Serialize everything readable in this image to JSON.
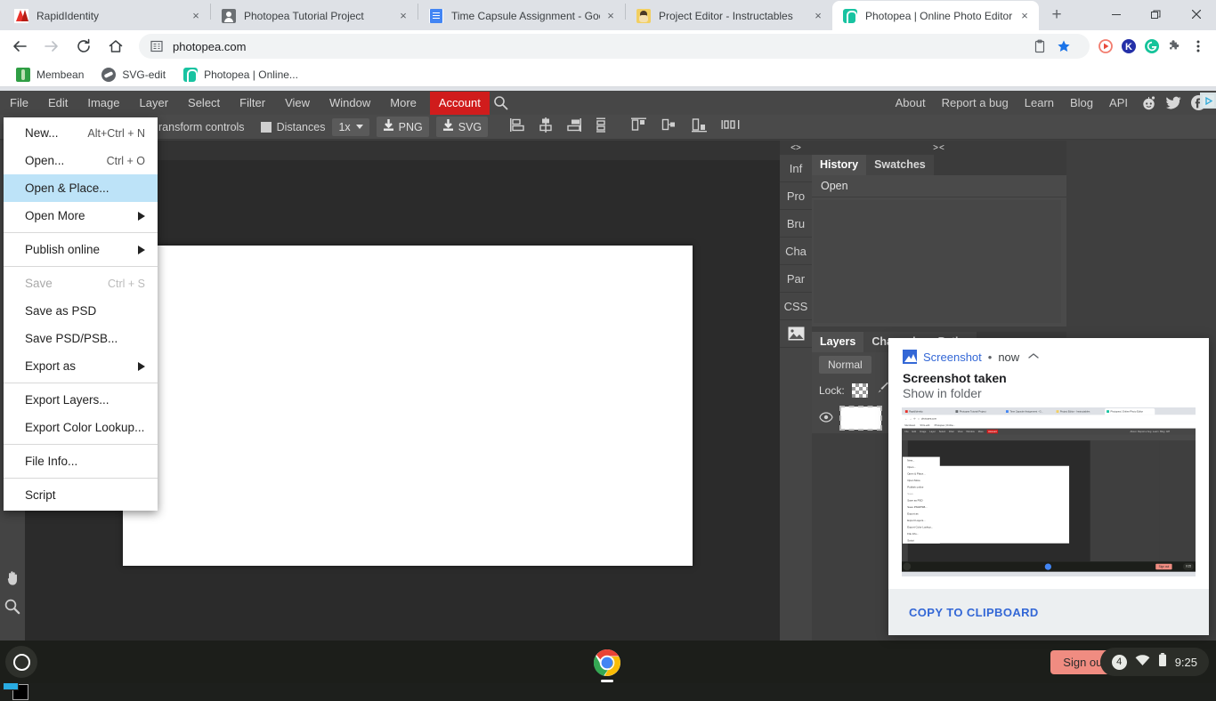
{
  "browser": {
    "tabs": [
      {
        "title": "RapidIdentity",
        "favicon": "rapididentity-icon",
        "active": false
      },
      {
        "title": "Photopea Tutorial Project",
        "favicon": "contact-card-icon",
        "active": false
      },
      {
        "title": "Time Capsule Assignment - Goo",
        "favicon": "google-docs-icon",
        "active": false
      },
      {
        "title": "Project Editor - Instructables",
        "favicon": "instructables-icon",
        "active": false
      },
      {
        "title": "Photopea | Online Photo Editor",
        "favicon": "photopea-icon",
        "active": true
      }
    ],
    "tab_close_label": "×",
    "new_tab_label": "+",
    "window_controls": {
      "minimize": "–",
      "maximize": "❐",
      "close": "✕"
    },
    "omnibox": {
      "url": "photopea.com",
      "site_icon": "page-info-icon"
    },
    "omnibox_actions": [
      "clipboard-icon",
      "bookmark-star-icon"
    ],
    "extensions": [
      "screencast-icon",
      "kami-icon",
      "grammarly-icon",
      "puzzle-icon",
      "chrome-menu-icon"
    ],
    "bookmarks": [
      {
        "label": "Membean",
        "icon": "membean-icon"
      },
      {
        "label": "SVG-edit",
        "icon": "svgedit-icon"
      },
      {
        "label": "Photopea | Online...",
        "icon": "photopea-icon"
      }
    ]
  },
  "photopea": {
    "menu": [
      "File",
      "Edit",
      "Image",
      "Layer",
      "Select",
      "Filter",
      "View",
      "Window",
      "More"
    ],
    "account_label": "Account",
    "search_icon": "magnifier-icon",
    "right_links": [
      "About",
      "Report a bug",
      "Learn",
      "Blog",
      "API"
    ],
    "social": [
      "reddit-icon",
      "twitter-icon",
      "facebook-icon"
    ],
    "options": {
      "transform_controls": "ransform controls",
      "distances": "Distances",
      "zoom_value": "1x",
      "png_label": "PNG",
      "svg_label": "SVG",
      "align_icons": [
        "align-left-icon",
        "align-center-horizontal-icon",
        "align-right-icon",
        "distribute-vertical-icon"
      ],
      "align_icons2": [
        "align-top-icon",
        "align-middle-icon",
        "align-bottom-icon",
        "distribute-horizontal-icon"
      ]
    },
    "tools": [
      "hand-tool",
      "zoom-tool"
    ],
    "colors": {
      "foreground": "#29abe2",
      "background": "#000000",
      "accent_red": "#d01c1c"
    },
    "side_strip": {
      "collapse": "<>",
      "items": [
        "Inf",
        "Pro",
        "Bru",
        "Cha",
        "Par",
        "CSS"
      ],
      "image_icon": "image-icon"
    },
    "panel_handle": "><",
    "top_panel": {
      "tabs": [
        "History",
        "Swatches"
      ],
      "active_tab": "History",
      "history_items": [
        "Open"
      ]
    },
    "layers_panel": {
      "tabs": [
        "Layers",
        "Channels",
        "Paths"
      ],
      "active_tab": "Layers",
      "blend_mode": "Normal",
      "lock_label": "Lock:",
      "eye_icon": "eye-icon",
      "lock_icons": [
        "transparency-lock-icon",
        "brush-lock-icon"
      ]
    }
  },
  "file_menu": {
    "items": [
      {
        "label": "New...",
        "shortcut": "Alt+Ctrl + N",
        "state": "normal"
      },
      {
        "label": "Open...",
        "shortcut": "Ctrl + O",
        "state": "normal"
      },
      {
        "label": "Open & Place...",
        "shortcut": "",
        "state": "selected"
      },
      {
        "label": "Open More",
        "shortcut": "",
        "state": "submenu"
      },
      {
        "separator": true
      },
      {
        "label": "Publish online",
        "shortcut": "",
        "state": "submenu"
      },
      {
        "separator": true
      },
      {
        "label": "Save",
        "shortcut": "Ctrl + S",
        "state": "disabled"
      },
      {
        "label": "Save as PSD",
        "shortcut": "",
        "state": "normal"
      },
      {
        "label": "Save PSD/PSB...",
        "shortcut": "",
        "state": "normal"
      },
      {
        "label": "Export as",
        "shortcut": "",
        "state": "submenu"
      },
      {
        "separator": true
      },
      {
        "label": "Export Layers...",
        "shortcut": "",
        "state": "normal"
      },
      {
        "label": "Export Color Lookup...",
        "shortcut": "",
        "state": "normal"
      },
      {
        "separator": true
      },
      {
        "label": "File Info...",
        "shortcut": "",
        "state": "normal"
      },
      {
        "separator": true
      },
      {
        "label": "Script",
        "shortcut": "",
        "state": "normal"
      }
    ]
  },
  "notification": {
    "app_name": "Screenshot",
    "separator": "•",
    "time": "now",
    "collapse_icon": "chevron-up-icon",
    "title": "Screenshot taken",
    "subtitle": "Show in folder",
    "action_label": "COPY TO CLIPBOARD",
    "thumbnail_alt": "screenshot-preview"
  },
  "shelf": {
    "launcher_icon": "launcher-icon",
    "apps": [
      {
        "name": "chrome-icon",
        "active": true
      }
    ],
    "sign_out_label": "Sign out",
    "tray": {
      "notification_count": "4",
      "wifi_icon": "wifi-icon",
      "battery_icon": "battery-icon",
      "clock": "9:25"
    }
  }
}
